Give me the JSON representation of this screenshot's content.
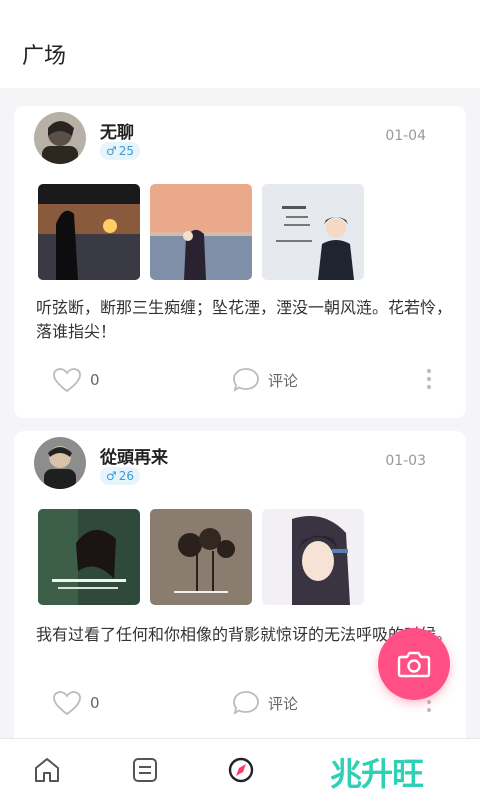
{
  "header": {
    "title": "广场"
  },
  "posts": [
    {
      "username": "无聊",
      "gender_symbol": "♂",
      "age": "25",
      "date": "01-04",
      "text": "听弦断，断那三生痴缠；坠花湮，湮没一朝风涟。花若怜，落谁指尖！",
      "likes": "0",
      "comment_label": "评论"
    },
    {
      "username": "從頭再来",
      "gender_symbol": "♂",
      "age": "26",
      "date": "01-03",
      "text": "我有过看了任何和你相像的背影就惊讶的无法呼吸的时候。",
      "likes": "0",
      "comment_label": "评论"
    }
  ],
  "tabbar": {
    "brand_text": "兆升旺"
  },
  "colors": {
    "accent": "#ff4f84",
    "badge_bg": "#e6f4fb",
    "badge_text": "#3a9bd5"
  }
}
